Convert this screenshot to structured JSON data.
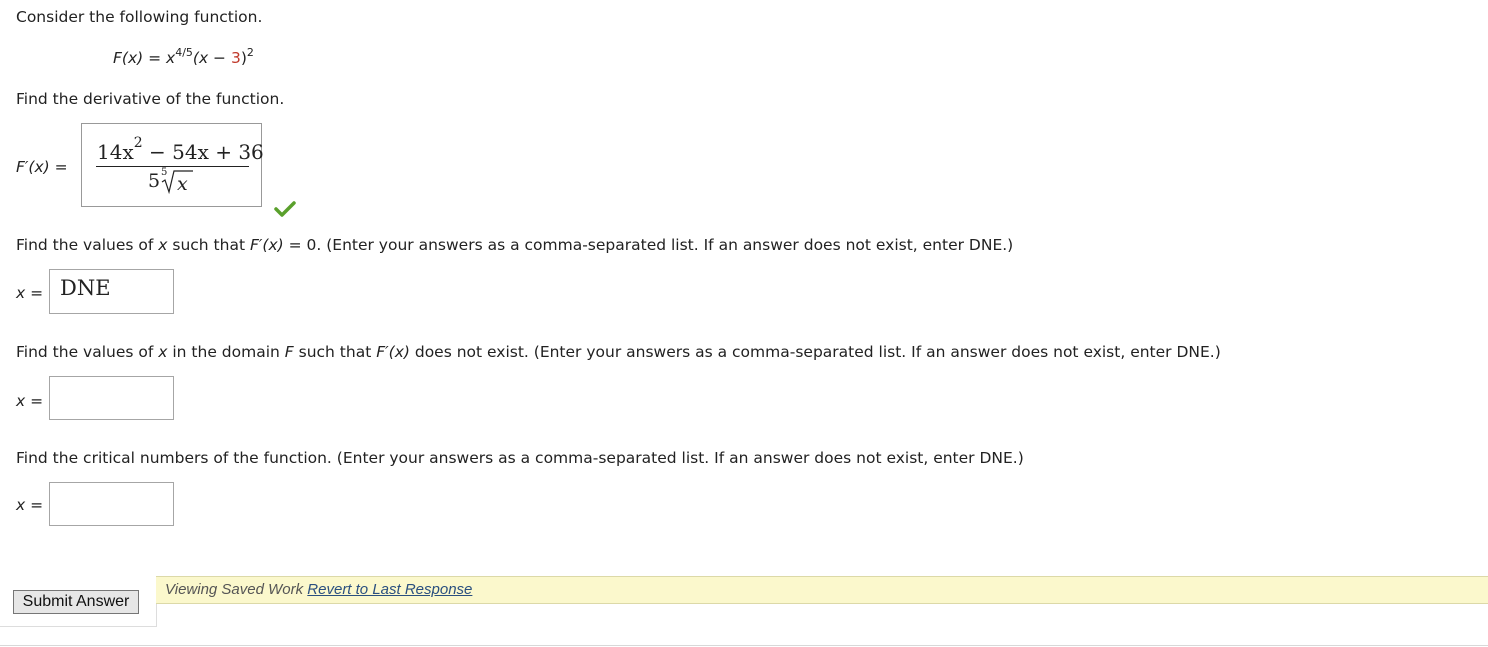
{
  "intro": "Consider the following function.",
  "function": {
    "lhs": "F(x) = x",
    "exp": "4/5",
    "mid": "(x − ",
    "red_value": "3",
    "close": ")",
    "outer_exp": "2"
  },
  "derivative": {
    "prompt": "Find the derivative of the function.",
    "label": "F′(x) =",
    "numerator": "14x",
    "num_exp": "2",
    "num_rest": " − 54x + 36",
    "den_coeff": "5",
    "root_index": "5",
    "radicand": "x",
    "status_icon": "checkmark-icon"
  },
  "q_zero": {
    "prompt_a": "Find the values of ",
    "var": "x",
    "prompt_b": " such that ",
    "fprime": "F′(x)",
    "prompt_c": " = 0. (Enter your answers as a comma-separated list. If an answer does not exist, enter DNE.)",
    "label": "x =",
    "value": "DNE"
  },
  "q_dne": {
    "prompt_a": "Find the values of ",
    "var": "x",
    "prompt_b": " in the domain ",
    "F": "F",
    "prompt_c": " such that ",
    "fprime": "F′(x)",
    "prompt_d": " does not exist. (Enter your answers as a comma-separated list. If an answer does not exist, enter DNE.)",
    "label": "x =",
    "value": ""
  },
  "q_critical": {
    "prompt": "Find the critical numbers of the function. (Enter your answers as a comma-separated list. If an answer does not exist, enter DNE.)",
    "label": "x =",
    "value": ""
  },
  "submit_label": "Submit Answer",
  "notice": {
    "text": "Viewing Saved Work ",
    "link": "Revert to Last Response"
  },
  "colors": {
    "accent_red": "#c0392b",
    "check_green": "#5aa02c",
    "notice_bg": "#fbf8cc"
  }
}
